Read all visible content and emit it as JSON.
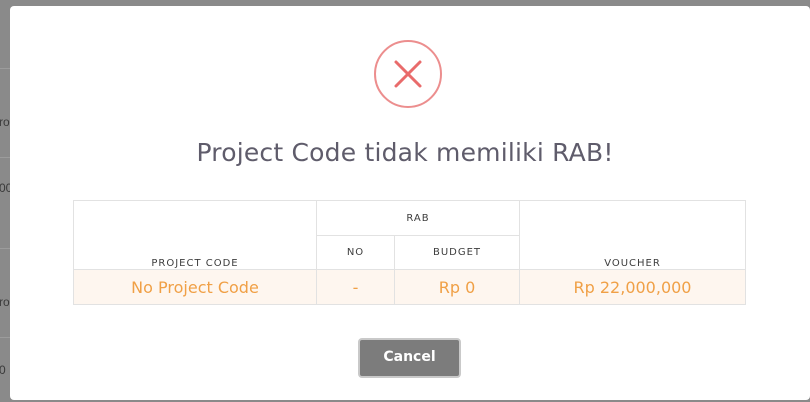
{
  "background": {
    "fragments": [
      "ro",
      "00",
      "ro",
      "0"
    ]
  },
  "modal": {
    "icon": "error-x-circle-icon",
    "title": "Project Code tidak memiliki RAB!",
    "table": {
      "headers": {
        "project_code": "PROJECT CODE",
        "rab": "RAB",
        "no": "NO",
        "budget": "BUDGET",
        "voucher": "VOUCHER"
      },
      "rows": [
        {
          "project_code": "No Project Code",
          "no": "-",
          "budget": "Rp 0",
          "voucher": "Rp 22,000,000"
        }
      ]
    },
    "cancel_label": "Cancel"
  },
  "colors": {
    "icon_stroke": "#ec8e8e",
    "highlight_text": "#f0a046",
    "highlight_row_bg": "#fef6ef",
    "button_bg": "#7c7c7c"
  }
}
